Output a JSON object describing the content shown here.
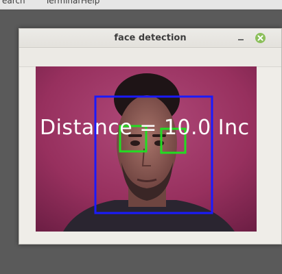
{
  "background_app": {
    "menu": [
      "earch",
      "Terminal",
      "Help"
    ]
  },
  "window": {
    "title": "face detection"
  },
  "frame": {
    "overlay_text": "Distance = 10.0 Inc",
    "detections": [
      {
        "label": "face",
        "color": "#1a1aff"
      },
      {
        "label": "left-eye",
        "color": "#22dd22"
      },
      {
        "label": "right-eye",
        "color": "#22dd22"
      }
    ]
  },
  "colors": {
    "close_button": "#8bbf5a",
    "face_box": "#1a1aff",
    "eye_box": "#22dd22"
  }
}
